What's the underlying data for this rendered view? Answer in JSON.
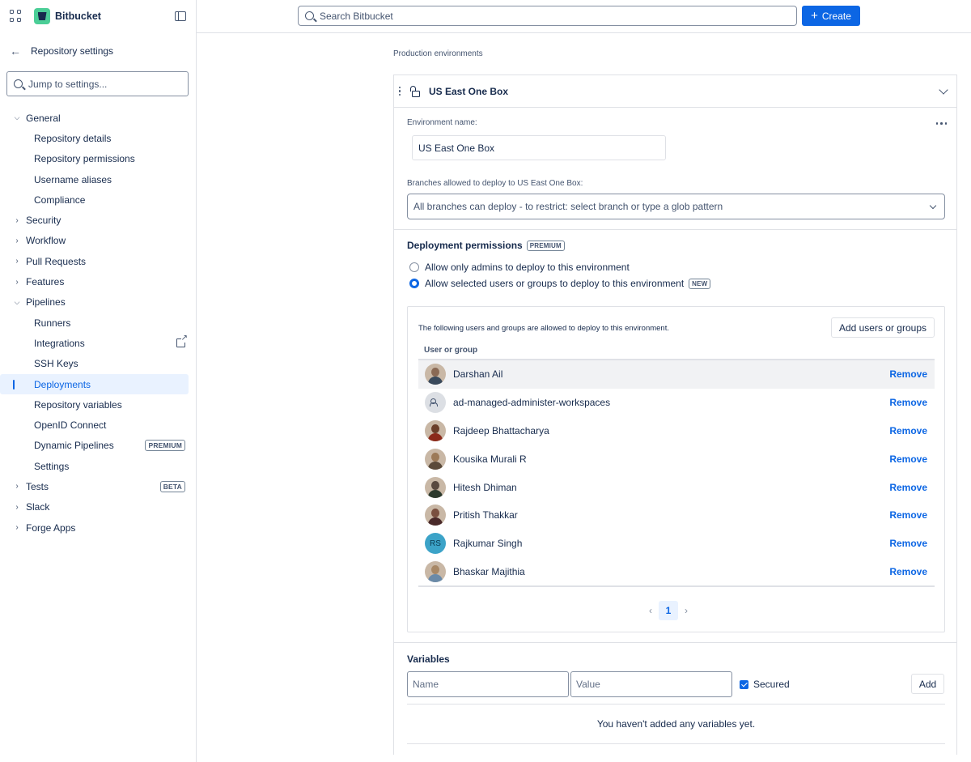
{
  "app": {
    "name": "Bitbucket"
  },
  "search": {
    "placeholder": "Search Bitbucket"
  },
  "create_button": {
    "label": "Create"
  },
  "sidebar": {
    "back_label": "Repository settings",
    "jump_placeholder": "Jump to settings...",
    "items": [
      {
        "label": "General",
        "type": "group",
        "expanded": true
      },
      {
        "label": "Repository details",
        "type": "sub"
      },
      {
        "label": "Repository permissions",
        "type": "sub"
      },
      {
        "label": "Username aliases",
        "type": "sub"
      },
      {
        "label": "Compliance",
        "type": "sub"
      },
      {
        "label": "Security",
        "type": "group",
        "expanded": false
      },
      {
        "label": "Workflow",
        "type": "group",
        "expanded": false
      },
      {
        "label": "Pull Requests",
        "type": "group",
        "expanded": false
      },
      {
        "label": "Features",
        "type": "group",
        "expanded": false
      },
      {
        "label": "Pipelines",
        "type": "group",
        "expanded": true
      },
      {
        "label": "Runners",
        "type": "sub"
      },
      {
        "label": "Integrations",
        "type": "sub",
        "icon": "external-link-icon"
      },
      {
        "label": "SSH Keys",
        "type": "sub"
      },
      {
        "label": "Deployments",
        "type": "sub",
        "active": true
      },
      {
        "label": "Repository variables",
        "type": "sub"
      },
      {
        "label": "OpenID Connect",
        "type": "sub"
      },
      {
        "label": "Dynamic Pipelines",
        "type": "sub",
        "badge": "PREMIUM"
      },
      {
        "label": "Settings",
        "type": "sub"
      },
      {
        "label": "Tests",
        "type": "group",
        "expanded": false,
        "badge": "BETA"
      },
      {
        "label": "Slack",
        "type": "group",
        "expanded": false
      },
      {
        "label": "Forge Apps",
        "type": "group",
        "expanded": false
      }
    ]
  },
  "main": {
    "section_title": "Production environments",
    "environment": {
      "title": "US East One Box",
      "name_label": "Environment name:",
      "name_value": "US East One Box",
      "branches_label": "Branches allowed to deploy to US East One Box:",
      "branches_placeholder": "All branches can deploy - to restrict: select branch or type a glob pattern"
    },
    "permissions": {
      "title": "Deployment permissions",
      "badge": "PREMIUM",
      "option_admins": "Allow only admins to deploy to this environment",
      "option_selected": "Allow selected users or groups to deploy to this environment",
      "option_selected_badge": "NEW",
      "selected_option": "selected",
      "users_description": "The following users and groups are allowed to deploy to this environment.",
      "add_button": "Add users or groups",
      "column_header": "User or group",
      "remove_label": "Remove",
      "users": [
        {
          "name": "Darshan Ail",
          "avatar": "photo",
          "skin": "#8a6a55",
          "shirt": "#3a4a5c"
        },
        {
          "name": "ad-managed-administer-workspaces",
          "avatar": "group"
        },
        {
          "name": "Rajdeep Bhattacharya",
          "avatar": "photo",
          "skin": "#6b3f2a",
          "shirt": "#8b2a1a"
        },
        {
          "name": "Kousika Murali R",
          "avatar": "photo",
          "skin": "#9c7a58",
          "shirt": "#5a4a3a"
        },
        {
          "name": "Hitesh Dhiman",
          "avatar": "photo",
          "skin": "#5a4a40",
          "shirt": "#2d3a2d"
        },
        {
          "name": "Pritish Thakkar",
          "avatar": "photo",
          "skin": "#7a5040",
          "shirt": "#4a2a2a"
        },
        {
          "name": "Rajkumar Singh",
          "avatar": "initials",
          "initials": "RS"
        },
        {
          "name": "Bhaskar Majithia",
          "avatar": "photo",
          "skin": "#a88866",
          "shirt": "#6a8aa8"
        }
      ],
      "pagination": {
        "current_page": "1",
        "prev": "‹",
        "next": "›"
      }
    },
    "variables": {
      "title": "Variables",
      "name_placeholder": "Name",
      "value_placeholder": "Value",
      "secured_label": "Secured",
      "secured_checked": true,
      "add_button": "Add",
      "empty_message": "You haven't added any variables yet."
    }
  }
}
